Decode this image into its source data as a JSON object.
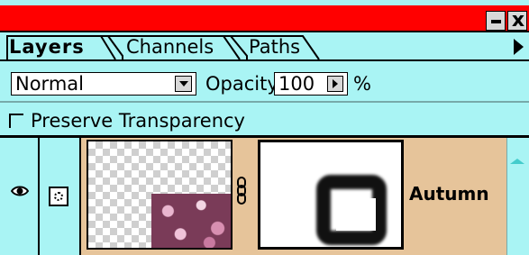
{
  "window": {
    "title": "",
    "controls": {
      "minimize_icon": "minimize-icon",
      "close_label": "x"
    },
    "colors": {
      "titlebar": "#ff0000",
      "panel": "#a9f4f4",
      "selected_layer": "#e6c49a"
    }
  },
  "tabs": [
    {
      "label": "Layers",
      "active": true
    },
    {
      "label": "Channels",
      "active": false
    },
    {
      "label": "Paths",
      "active": false
    }
  ],
  "blend_mode": {
    "value": "Normal"
  },
  "opacity": {
    "label": "Opacity:",
    "value": "100",
    "unit": "%"
  },
  "preserve_transparency": {
    "label": "Preserve Transparency",
    "checked": false
  },
  "layers": [
    {
      "name": "Autumn",
      "visible": true,
      "mask_active": true,
      "linked": true
    }
  ]
}
